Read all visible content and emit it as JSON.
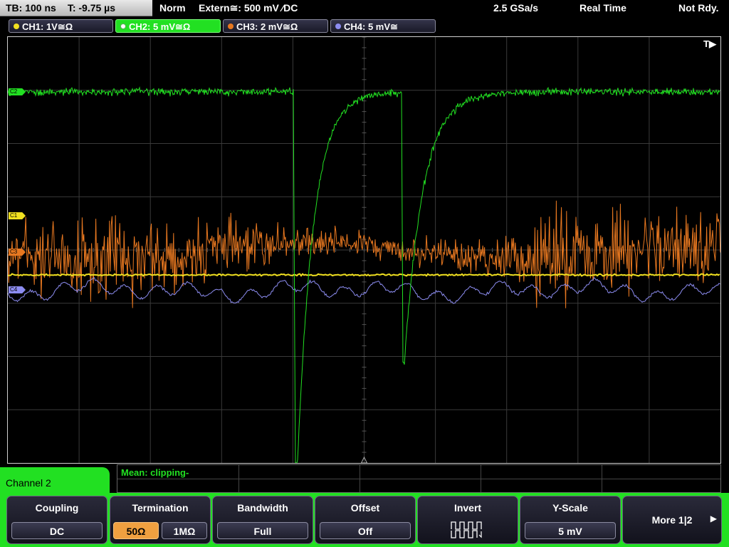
{
  "topbar": {
    "tb": "TB: 100 ns",
    "t": "T: -9.75 µs",
    "mode": "Norm",
    "trigger": "Extern≅: 500 mV ⁄DC",
    "sample_rate": "2.5 GSa/s",
    "acq": "Real Time",
    "status": "Not Rdy."
  },
  "channels": [
    {
      "label": "CH1: 1V≅Ω",
      "color": "#f0e020"
    },
    {
      "label": "CH2: 5 mV≅Ω",
      "color": "#22e022"
    },
    {
      "label": "CH3: 2 mV≅Ω",
      "color": "#e87820"
    },
    {
      "label": "CH4: 5 mV≅",
      "color": "#8c8cf0"
    }
  ],
  "scope": {
    "trigger_marker": "T▶",
    "markers": {
      "c1": "C1",
      "c2": "C2",
      "c3": "C3",
      "c4": "C4"
    },
    "trace_colors": {
      "ch1": "#f0e020",
      "ch2": "#22e022",
      "ch3": "#e87820",
      "ch4": "#8c8cf0"
    }
  },
  "measurement": {
    "text": "Mean: clipping-"
  },
  "channel_menu": {
    "label": "Channel 2"
  },
  "softkeys": {
    "coupling": {
      "title": "Coupling",
      "value": "DC"
    },
    "termination": {
      "title": "Termination",
      "opt1": "50Ω",
      "opt2": "1MΩ"
    },
    "bandwidth": {
      "title": "Bandwidth",
      "value": "Full"
    },
    "offset": {
      "title": "Offset",
      "value": "Off"
    },
    "invert": {
      "title": "Invert"
    },
    "yscale": {
      "title": "Y-Scale",
      "value": "5 mV"
    },
    "more": {
      "label": "More 1|2",
      "arrow": "▶"
    }
  }
}
